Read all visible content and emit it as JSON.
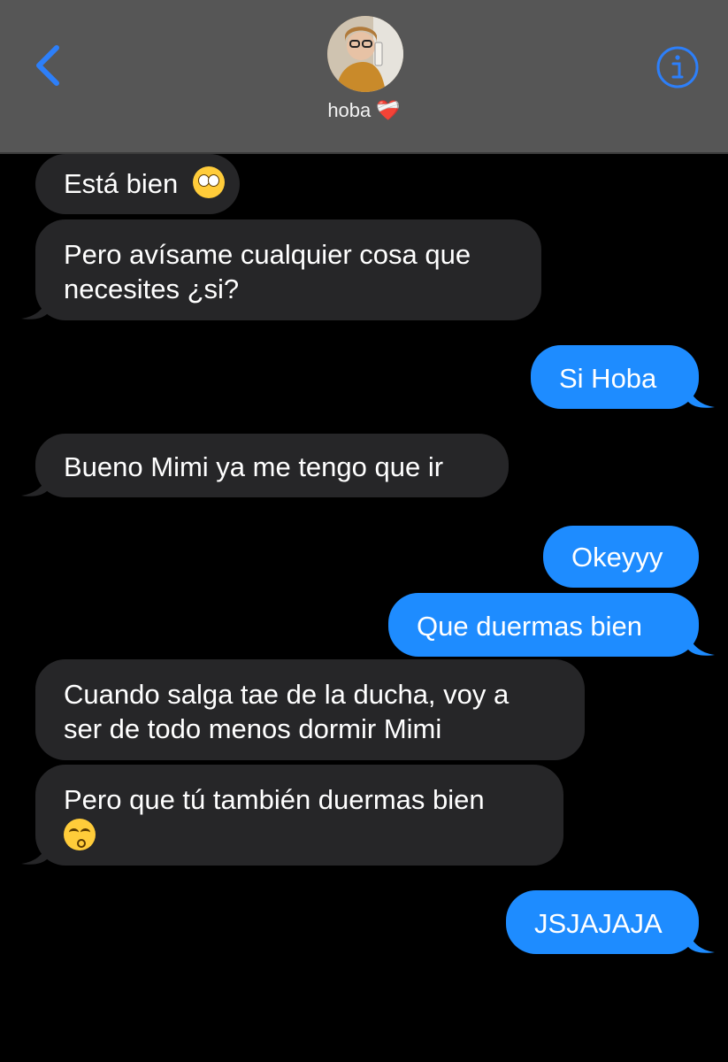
{
  "header": {
    "contact_name": "hoba",
    "name_emoji": "❤️‍🩹",
    "back_icon": "chevron-left-icon",
    "info_icon": "info-circle-icon",
    "accent_color": "#2d7ff9"
  },
  "messages": [
    {
      "from": "them",
      "text": "Está bien",
      "emoji": "face-with-rolling-eyes"
    },
    {
      "from": "them",
      "line1": "Pero avísame cualquier cosa que",
      "line2": "necesites ¿si?"
    },
    {
      "from": "me",
      "text": "Si Hoba"
    },
    {
      "from": "them",
      "text": "Bueno Mimi ya me tengo que ir"
    },
    {
      "from": "me",
      "text": "Okeyyy"
    },
    {
      "from": "me",
      "text": "Que duermas bien"
    },
    {
      "from": "them",
      "line1": "Cuando salga tae de la ducha, voy a",
      "line2": "ser de todo menos dormir Mimi"
    },
    {
      "from": "them",
      "line1": "Pero que tú también duermas bien",
      "emoji": "kissing-face-with-smiling-eyes"
    },
    {
      "from": "me",
      "text": "JSJAJAJA"
    }
  ],
  "colors": {
    "incoming_bubble": "#262628",
    "outgoing_bubble": "#1e8cff",
    "header_bg": "#565656",
    "background": "#000000"
  }
}
